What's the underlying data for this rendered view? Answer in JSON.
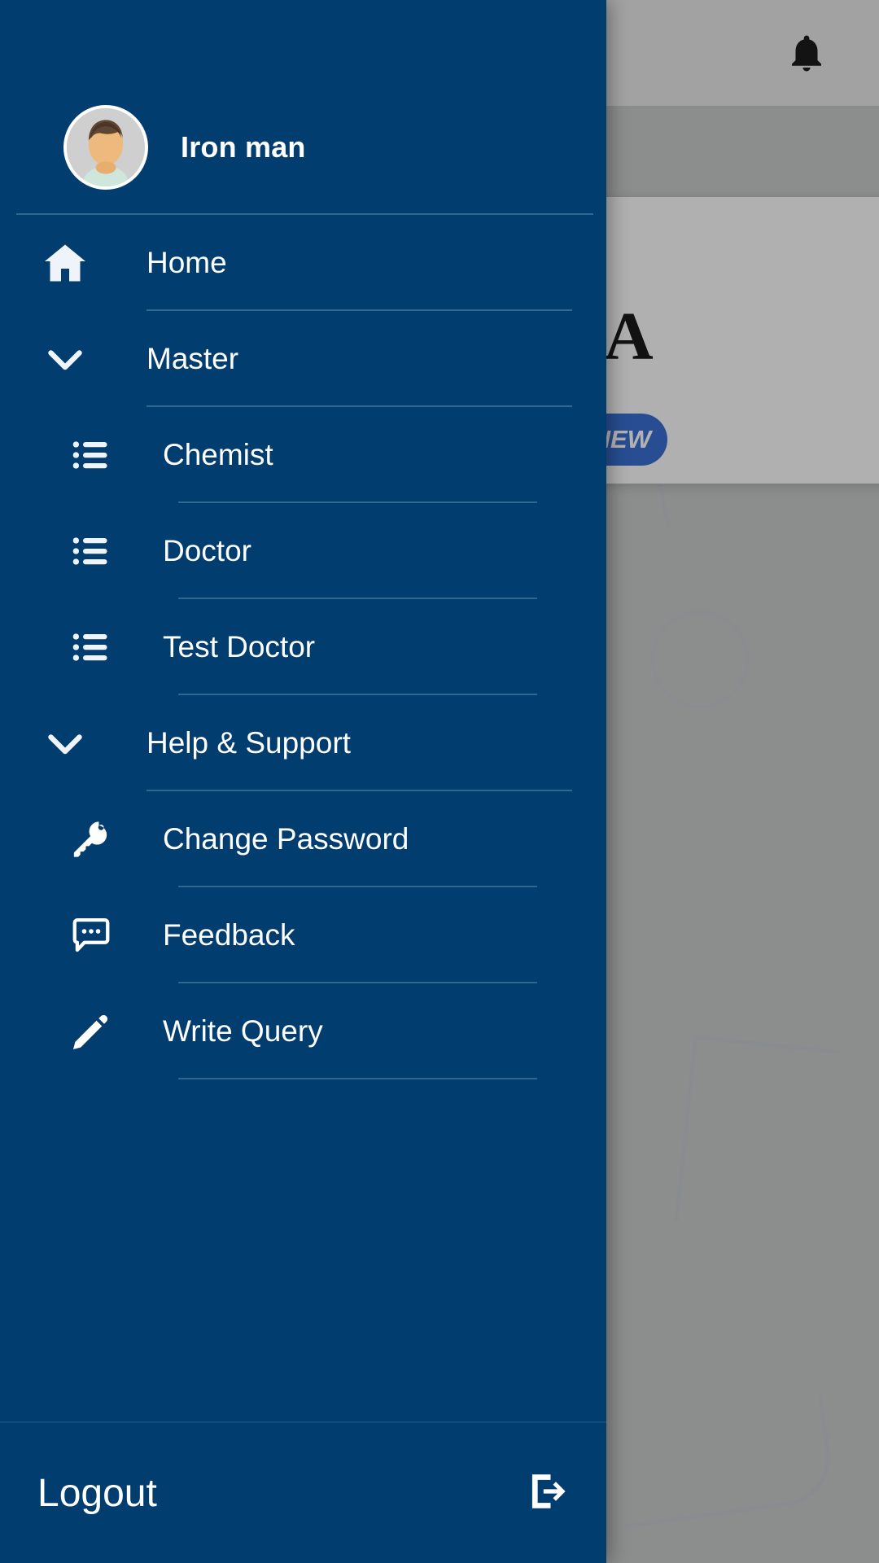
{
  "theme": {
    "drawer_bg": "#023d70",
    "divider": "#2f6791",
    "text": "#ffffff",
    "accent_button": "#3a6fd1",
    "page_bg": "#c9cbcb"
  },
  "background": {
    "notification_icon": "bell-icon",
    "card": {
      "glyph": "A",
      "button_label": "NEW"
    }
  },
  "drawer": {
    "profile": {
      "name": "Iron man",
      "avatar_icon": "user-avatar"
    },
    "items": [
      {
        "label": "Home",
        "icon": "home-icon",
        "level": 1,
        "name": "sidebar-item-home"
      },
      {
        "label": "Master",
        "icon": "chevron-down-icon",
        "level": 1,
        "name": "sidebar-item-master"
      },
      {
        "label": "Chemist",
        "icon": "list-icon",
        "level": 2,
        "name": "sidebar-item-chemist"
      },
      {
        "label": "Doctor",
        "icon": "list-icon",
        "level": 2,
        "name": "sidebar-item-doctor"
      },
      {
        "label": "Test Doctor",
        "icon": "list-icon",
        "level": 2,
        "name": "sidebar-item-test-doctor"
      },
      {
        "label": "Help & Support",
        "icon": "chevron-down-icon",
        "level": 1,
        "name": "sidebar-item-help-support"
      },
      {
        "label": "Change Password",
        "icon": "key-icon",
        "level": 2,
        "name": "sidebar-item-change-password"
      },
      {
        "label": "Feedback",
        "icon": "chat-icon",
        "level": 2,
        "name": "sidebar-item-feedback"
      },
      {
        "label": "Write Query",
        "icon": "pencil-icon",
        "level": 2,
        "name": "sidebar-item-write-query"
      }
    ],
    "footer": {
      "logout_label": "Logout",
      "logout_icon": "logout-icon"
    }
  }
}
